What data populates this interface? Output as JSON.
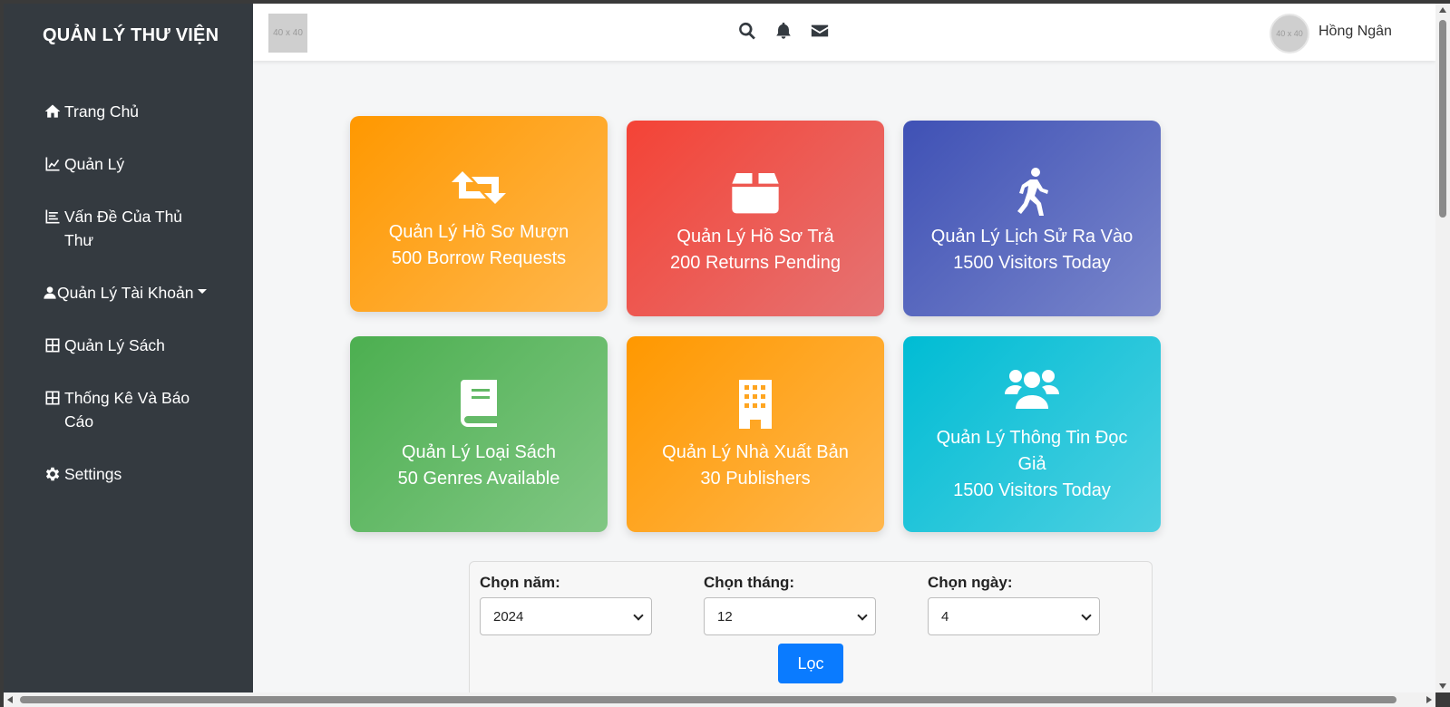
{
  "sidebar": {
    "brand": "QUẢN LÝ THƯ VIỆN",
    "items": [
      {
        "label": "Trang Chủ",
        "icon": "home-icon"
      },
      {
        "label": "Quản Lý",
        "icon": "chart-line-icon"
      },
      {
        "label": "Vấn Đề Của Thủ Thư",
        "icon": "list-icon"
      },
      {
        "label": "Quản Lý Tài Khoản",
        "icon": "user-icon"
      },
      {
        "label": "Quản Lý Sách",
        "icon": "table-icon"
      },
      {
        "label": "Thống Kê Và Báo Cáo",
        "icon": "table-icon"
      },
      {
        "label": "Settings",
        "icon": "gear-icon"
      }
    ]
  },
  "topbar": {
    "logo_placeholder": "40 x 40",
    "avatar_placeholder": "40 x 40",
    "username": "Hồng Ngân",
    "icons": [
      "search-icon",
      "bell-icon",
      "envelope-icon"
    ]
  },
  "cards": [
    {
      "title": "Quản Lý Hồ Sơ Mượn",
      "subtitle": "500 Borrow Requests",
      "icon": "retweet-icon",
      "color": "#ff9800"
    },
    {
      "title": "Quản Lý Hồ Sơ Trả",
      "subtitle": "200 Returns Pending",
      "icon": "box-icon",
      "color": "#f44336"
    },
    {
      "title": "Quản Lý Lịch Sử Ra Vào",
      "subtitle": "1500 Visitors Today",
      "icon": "walking-icon",
      "color": "#3f51b5"
    },
    {
      "title": "Quản Lý Loại Sách",
      "subtitle": "50 Genres Available",
      "icon": "book-icon",
      "color": "#4caf50"
    },
    {
      "title": "Quản Lý Nhà Xuất Bản",
      "subtitle": "30 Publishers",
      "icon": "building-icon",
      "color": "#ff9800"
    },
    {
      "title": "Quản Lý Thông Tin Đọc Giả",
      "subtitle": "1500 Visitors Today",
      "icon": "users-icon",
      "color": "#00bcd4"
    }
  ],
  "filter": {
    "year_label": "Chọn năm:",
    "year_value": "2024",
    "month_label": "Chọn tháng:",
    "month_value": "12",
    "day_label": "Chọn ngày:",
    "day_value": "4",
    "button_label": "Lọc",
    "button_color": "#0a7bff"
  }
}
